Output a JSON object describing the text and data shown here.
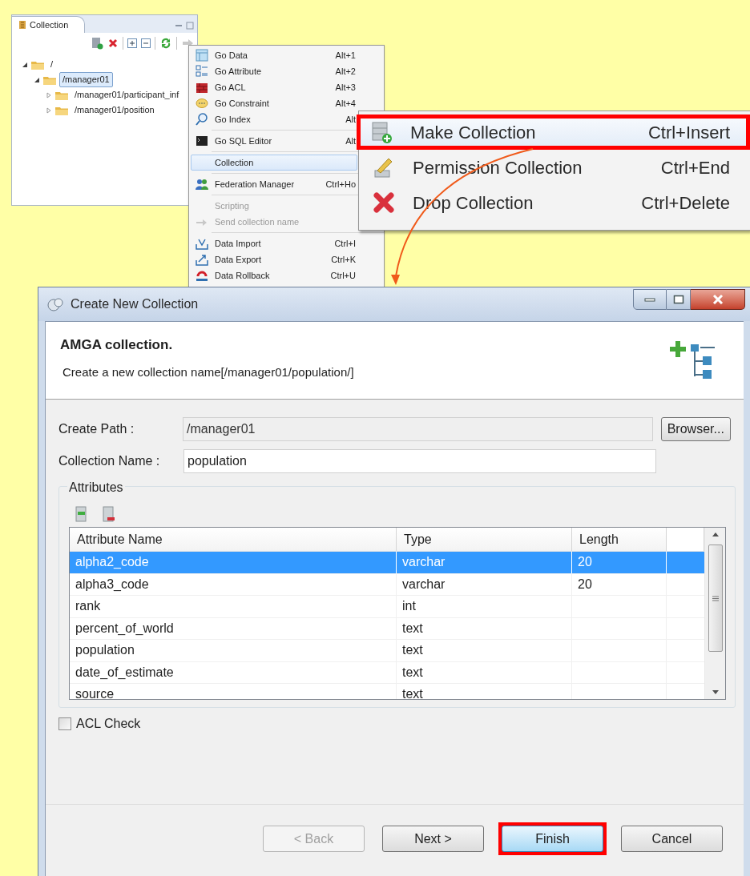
{
  "collection_view": {
    "tab": "Collection",
    "tree": [
      {
        "label": "/",
        "expanded": true,
        "selected": false,
        "children": [
          {
            "label": "/manager01",
            "expanded": true,
            "selected": true,
            "children": [
              {
                "label": "/manager01/participant_inf",
                "expanded": false,
                "selected": false
              },
              {
                "label": "/manager01/position",
                "expanded": false,
                "selected": false
              }
            ]
          }
        ]
      }
    ]
  },
  "context_menu": {
    "groups": [
      [
        {
          "label": "Go Data",
          "shortcut": "Alt+1",
          "disabled": false,
          "selected": false
        },
        {
          "label": "Go Attribute",
          "shortcut": "Alt+2",
          "disabled": false,
          "selected": false
        },
        {
          "label": "Go ACL",
          "shortcut": "Alt+3",
          "disabled": false,
          "selected": false
        },
        {
          "label": "Go Constraint",
          "shortcut": "Alt+4",
          "disabled": false,
          "selected": false
        },
        {
          "label": "Go Index",
          "shortcut": "Alt",
          "disabled": false,
          "selected": false
        }
      ],
      [
        {
          "label": "Go SQL Editor",
          "shortcut": "Alt",
          "disabled": false,
          "selected": false
        }
      ],
      [
        {
          "label": "Collection",
          "disabled": false,
          "selected": true
        }
      ],
      [
        {
          "label": "Federation Manager",
          "shortcut": "Ctrl+Ho",
          "disabled": false,
          "selected": false
        }
      ],
      [
        {
          "label": "Scripting",
          "disabled": true,
          "selected": false
        },
        {
          "label": "Send collection name",
          "disabled": true,
          "selected": false
        }
      ],
      [
        {
          "label": "Data Import",
          "shortcut": "Ctrl+I",
          "disabled": false,
          "selected": false
        },
        {
          "label": "Data Export",
          "shortcut": "Ctrl+K",
          "disabled": false,
          "selected": false
        },
        {
          "label": "Data Rollback",
          "shortcut": "Ctrl+U",
          "disabled": false,
          "selected": false
        }
      ]
    ]
  },
  "submenu": {
    "items": [
      {
        "label": "Make Collection",
        "shortcut": "Ctrl+Insert",
        "selected": true,
        "highlighted": true
      },
      {
        "label": "Permission Collection",
        "shortcut": "Ctrl+End",
        "selected": false,
        "highlighted": false
      },
      {
        "label": "Drop Collection",
        "shortcut": "Ctrl+Delete",
        "selected": false,
        "highlighted": false
      }
    ]
  },
  "dialog": {
    "title": "Create New Collection",
    "heading": "AMGA collection.",
    "description": "Create a new collection name[/manager01/population/]",
    "create_path": {
      "label": "Create Path :",
      "value": "/manager01",
      "disabled": true
    },
    "browse_button": "Browser...",
    "collection_name": {
      "label": "Collection Name :",
      "value": "population",
      "disabled": false
    },
    "attributes": {
      "title": "Attributes",
      "columns": [
        "Attribute Name",
        "Type",
        "Length"
      ],
      "rows": [
        {
          "cells": [
            "alpha2_code",
            "varchar",
            "20"
          ],
          "selected": true
        },
        {
          "cells": [
            "alpha3_code",
            "varchar",
            "20"
          ],
          "selected": false
        },
        {
          "cells": [
            "rank",
            "int",
            ""
          ],
          "selected": false
        },
        {
          "cells": [
            "percent_of_world",
            "text",
            ""
          ],
          "selected": false
        },
        {
          "cells": [
            "population",
            "text",
            ""
          ],
          "selected": false
        },
        {
          "cells": [
            "date_of_estimate",
            "text",
            ""
          ],
          "selected": false
        },
        {
          "cells": [
            "source",
            "text",
            ""
          ],
          "selected": false
        }
      ]
    },
    "acl_check": {
      "label": "ACL Check",
      "checked": false
    },
    "buttons": [
      {
        "label": "< Back",
        "disabled": true,
        "highlighted": false
      },
      {
        "label": "Next >",
        "disabled": false,
        "highlighted": false
      },
      {
        "label": "Finish",
        "disabled": false,
        "highlighted": true
      },
      {
        "label": "Cancel",
        "disabled": false,
        "highlighted": false
      }
    ]
  }
}
